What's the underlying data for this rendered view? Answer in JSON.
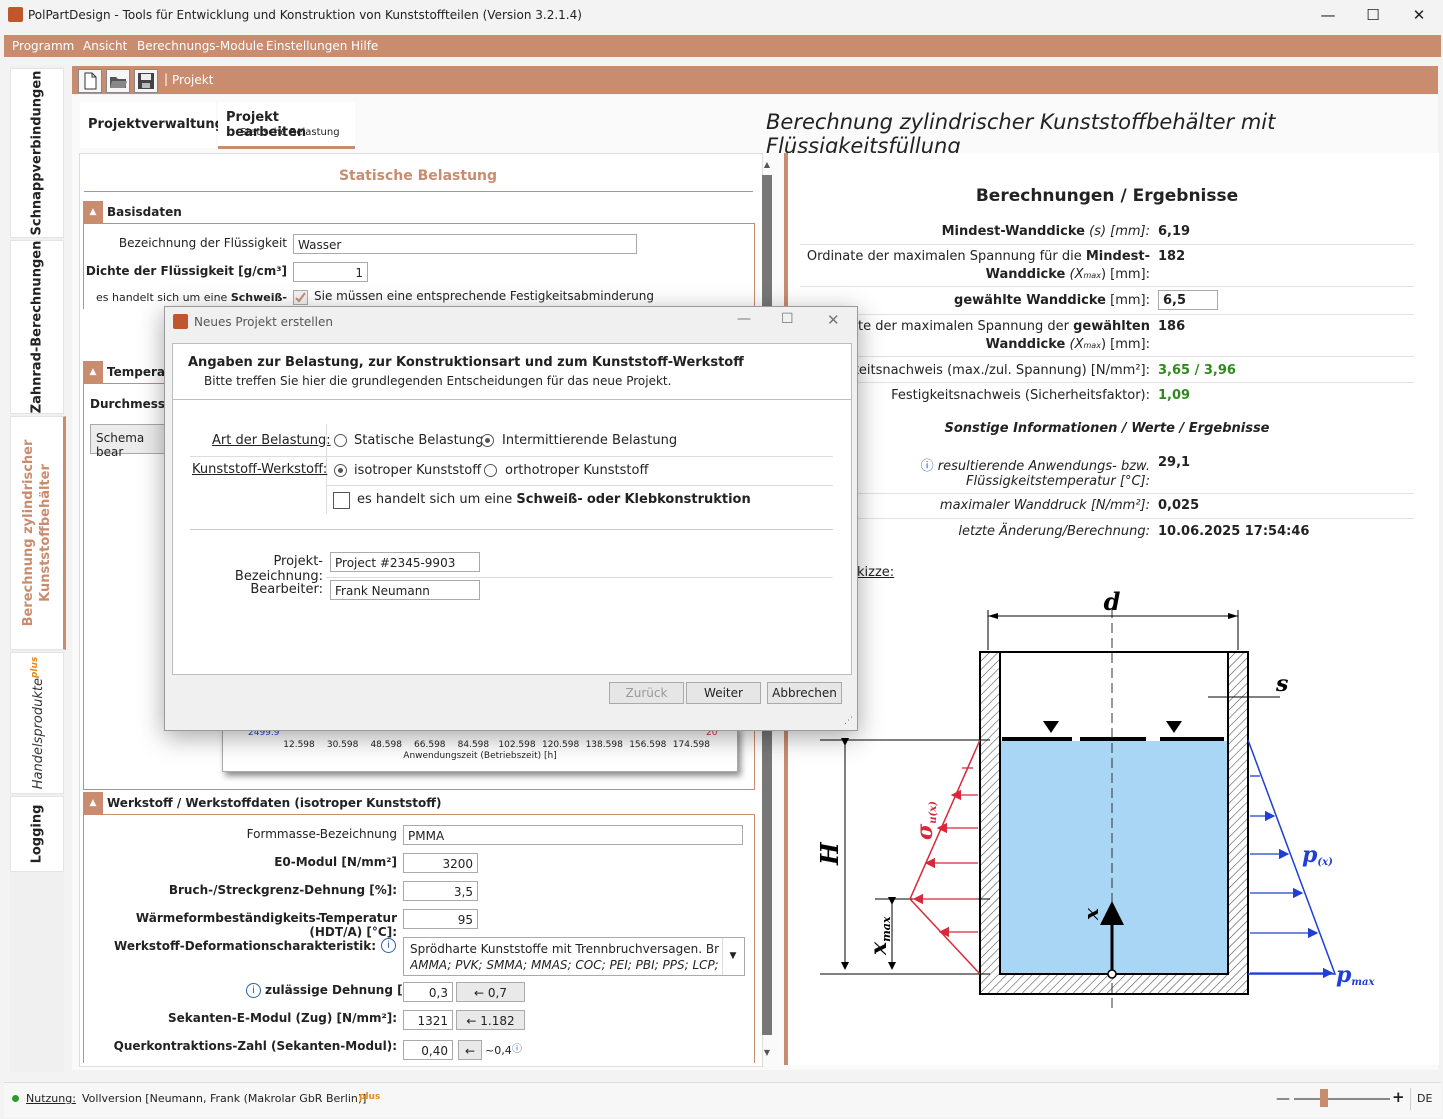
{
  "window": {
    "title": "PolPartDesign - Tools für Entwicklung und Konstruktion von Kunststoffteilen (Version 3.2.1.4)"
  },
  "menu": [
    "Programm",
    "Ansicht",
    "Berechnungs-Module",
    "Einstellungen",
    "Hilfe"
  ],
  "sidebar": {
    "items": [
      {
        "label": "Schnappverbindungen"
      },
      {
        "label": "Zahnrad-Berechnungen"
      },
      {
        "label_line1": "Berechnung zylindrischer",
        "label_line2": "Kunststoffbehälter"
      },
      {
        "label": "Handelsprodukte",
        "badge": "plus"
      },
      {
        "label": "Logging"
      }
    ]
  },
  "toolbar": {
    "project_label": "Projekt"
  },
  "tabs": {
    "tab1": "Projektverwaltung",
    "tab2_title": "Projekt bearbeiten",
    "tab2_sub": "Statische Belastung"
  },
  "page_title": "Berechnung zylindrischer Kunststoffbehälter mit Flüssigkeitsfüllung",
  "left": {
    "header": "Statische Belastung",
    "basisdaten": {
      "title": "Basisdaten",
      "fluid_name_label": "Bezeichnung der Flüssigkeit",
      "fluid_name_value": "Wasser",
      "density_label": "Dichte der Flüssigkeit [g/cm³]",
      "density_value": "1",
      "weld_label_a": "es handelt sich um eine",
      "weld_label_b": "Schweiß-",
      "weld_note": "Sie müssen eine entsprechende Festigkeitsabminderung"
    },
    "temperatur": {
      "title": "Temperatu",
      "durchmesser": "Durchmesser",
      "schema": "Schema bear"
    },
    "chart_fragment": {
      "y_tick": "2499.9",
      "y2_tick": "20",
      "x_ticks": [
        "12.598",
        "30.598",
        "48.598",
        "66.598",
        "84.598",
        "102.598",
        "120.598",
        "138.598",
        "156.598",
        "174.598"
      ],
      "x_label": "Anwendungszeit (Betriebszeit) [h]"
    },
    "werkstoff": {
      "title": "Werkstoff / Werkstoffdaten (isotroper Kunststoff)",
      "formmasse_label": "Formmasse-Bezeichnung",
      "formmasse_value": "PMMA",
      "e0_label": "E0-Modul [N/mm²]",
      "e0_value": "3200",
      "bruch_label": "Bruch-/Streckgrenz-Dehnung [%]:",
      "bruch_value": "3,5",
      "hdt_label": "Wärmeformbeständigkeits-Temperatur (HDT/A) [°C]:",
      "hdt_value": "95",
      "deform_label": "Werkstoff-Deformationscharakteristik:",
      "deform_line1": "Sprödharte Kunststoffe mit Trennbruchversagen. Bruchdeh",
      "deform_line2": "AMMA; PVK; SMMA; MMAS; COC; PEI; PBI; PPS; LCP; EP; UF",
      "dehnung_label": "zulässige Dehnung [%]:",
      "dehnung_value": "0,3",
      "dehnung_btn": "← 0,7",
      "sekanten_label": "Sekanten-E-Modul (Zug) [N/mm²]:",
      "sekanten_value": "1321",
      "sekanten_btn": "← 1.182",
      "quer_label": "Querkontraktions-Zahl (Sekanten-Modul):",
      "quer_value": "0,40",
      "quer_btn": "←",
      "quer_hint": "~0,4"
    }
  },
  "right": {
    "title": "Berechnungen / Ergebnisse",
    "rows": {
      "r1_label": "Mindest-Wanddicke",
      "r1_unit": "(s) [mm]:",
      "r1_value": "6,19",
      "r2_label_a": "Ordinate der maximalen Spannung für die",
      "r2_label_b": "Mindest-",
      "r2_label_c": "Wanddicke",
      "r2_unit": "(X",
      "r2_sub": "max",
      "r2_unit2": ") [mm]:",
      "r2_value": "182",
      "r3_label": "gewählte Wanddicke",
      "r3_unit": "[mm]:",
      "r3_value": "6,5",
      "r4_label_a": "dinate der maximalen Spannung der",
      "r4_label_b": "gewählten",
      "r4_label_c": "Wanddicke",
      "r4_unit": "(X",
      "r4_sub": "max",
      "r4_unit2": ") [mm]:",
      "r4_value": "186",
      "r5_label": "tigkeitsnachweis (max./zul. Spannung) [N/mm²]:",
      "r5_value": "3,65 / 3,96",
      "r6_label": "Festigkeitsnachweis (Sicherheitsfaktor):",
      "r6_value": "1,09"
    },
    "other_title": "Sonstige Informationen / Werte / Ergebnisse",
    "other": {
      "o1_label_a": "resultierende Anwendungs- bzw.",
      "o1_label_b": "Flüssigkeitstemperatur [°C]:",
      "o1_value": "29,1",
      "o2_label": "maximaler Wanddruck [N/mm²]:",
      "o2_value": "0,025",
      "o3_label": "letzte Änderung/Berechnung:",
      "o3_value": "10.06.2025 17:54:46"
    },
    "sketch_label": "kizze:",
    "sketch": {
      "d": "d",
      "s": "s",
      "H": "H",
      "x": "x",
      "xmax": "x",
      "xmax_sub": "max",
      "sigma": "σ",
      "sigma_sub": "u(x)",
      "p": "p",
      "p_sub": "(x)",
      "pmax": "p",
      "pmax_sub": "max"
    }
  },
  "dialog": {
    "title": "Neues Projekt erstellen",
    "heading": "Angaben zur Belastung, zur Konstruktionsart und zum Kunststoff-Werkstoff",
    "subheading": "Bitte treffen Sie hier die grundlegenden Entscheidungen für das neue Projekt.",
    "art_label": "Art der Belastung:",
    "opt_static": "Statische Belastung",
    "opt_intermittent": "Intermittierende Belastung",
    "werkstoff_label": "Kunststoff-Werkstoff:",
    "opt_iso": "isotroper Kunststoff",
    "opt_ortho": "orthotroper Kunststoff",
    "weld_a": "es handelt sich um eine",
    "weld_b": "Schweiß-",
    "weld_c": "oder",
    "weld_d": "Klebkonstruktion",
    "proj_label": "Projekt-Bezeichnung:",
    "proj_value": "Project #2345-9903",
    "bearb_label": "Bearbeiter:",
    "bearb_value": "Frank Neumann",
    "btn_back": "Zurück",
    "btn_next": "Weiter",
    "btn_cancel": "Abbrechen"
  },
  "status": {
    "nutzung_label": "Nutzung:",
    "nutzung_value": "Vollversion [Neumann, Frank (Makrolar GbR Berlin)]",
    "badge": "plus",
    "lang": "DE"
  },
  "colors": {
    "accent": "#c98c6e",
    "green": "#2e8a1c",
    "water": "#a9d6f5",
    "red": "#d8283a",
    "blue": "#1f3fd6"
  }
}
